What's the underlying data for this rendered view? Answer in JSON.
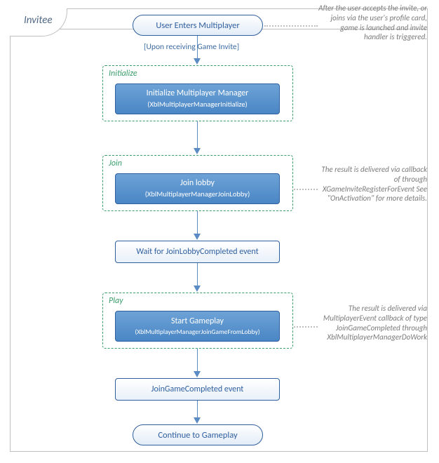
{
  "header": {
    "invitee_label": "Invitee"
  },
  "entry": {
    "label": "User Enters Multiplayer",
    "annotation": "After the user accepts the invite, or joins via the user's profile card, game is launched and invite handler is triggered."
  },
  "condition": "[Upon receiving Game Invite]",
  "initialize": {
    "phase_label": "Initialize",
    "action_title": "Initialize Multiplayer Manager",
    "action_sub": "(XblMultiplayerManagerInitialize)"
  },
  "join": {
    "phase_label": "Join",
    "action_title": "Join lobby",
    "action_sub": "(XblMultiplayerManagerJoinLobby)",
    "annotation": "The result is delivered via callback of through XGameInviteRegisterForEvent See \"OnActivation\" for more details."
  },
  "wait": {
    "label": "Wait for JoinLobbyCompleted event"
  },
  "play": {
    "phase_label": "Play",
    "action_title": "Start Gameplay",
    "action_sub": "(XblMultiplayerManagerJoinGameFromLobby)",
    "annotation": "The result is delivered via MultiplayerEvent callback of type JoinGameCompleted through XblMultiplayerManagerDoWork"
  },
  "join_game_completed": {
    "label": "JoinGameCompleted event"
  },
  "continue": {
    "label": "Continue to Gameplay"
  }
}
